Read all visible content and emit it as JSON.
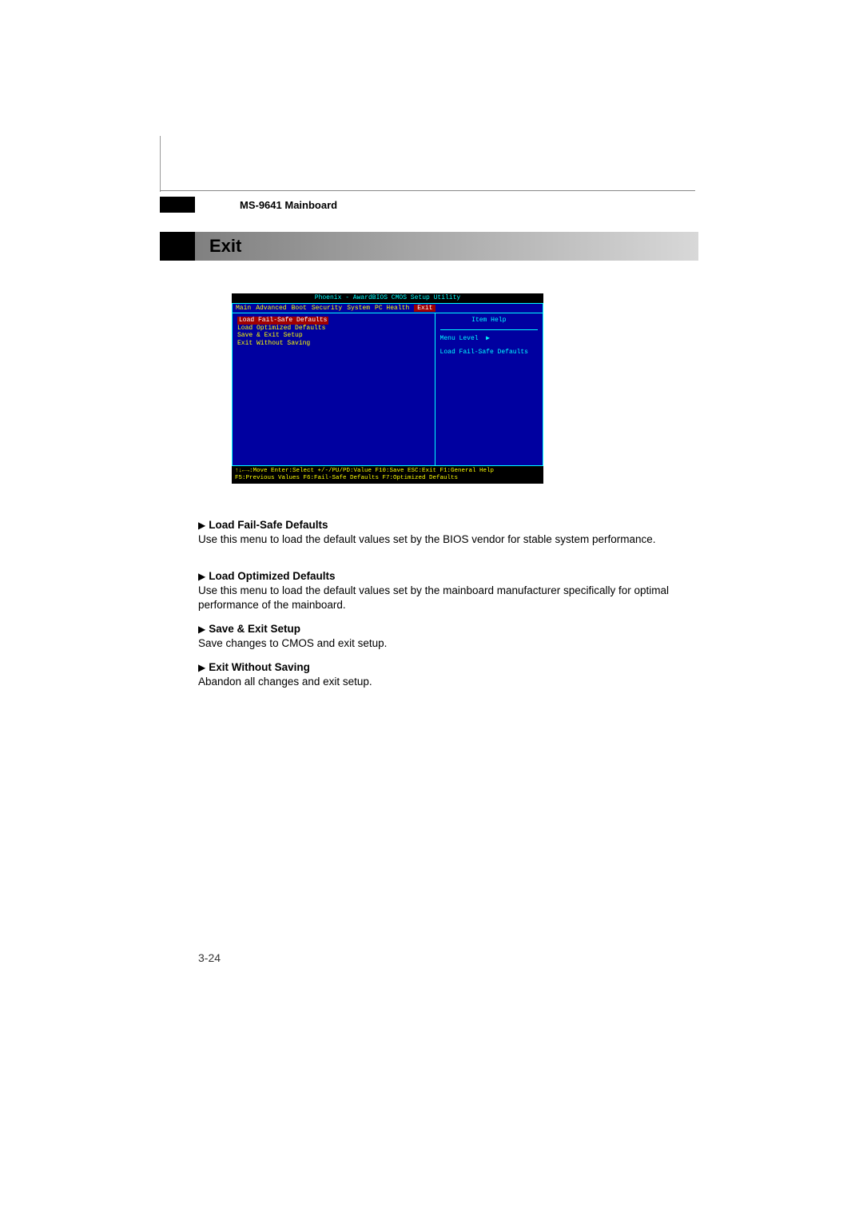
{
  "header": {
    "product": "MS-9641 Mainboard"
  },
  "section": {
    "title": "Exit"
  },
  "bios": {
    "title": "Phoenix - AwardBIOS CMOS Setup Utility",
    "menubar": [
      "Main",
      "Advanced",
      "Boot",
      "Security",
      "System",
      "PC Health",
      "Exit"
    ],
    "selected_tab": "Exit",
    "left_items": [
      "Load Fail-Safe Defaults",
      "Load Optimized Defaults",
      "Save & Exit Setup",
      "Exit Without Saving"
    ],
    "highlighted": "Load Fail-Safe Defaults",
    "right": {
      "item_help": "Item Help",
      "menu_level": "Menu Level",
      "help_text": "Load Fail-Safe Defaults"
    },
    "footer_line1": "↑↓←→:Move  Enter:Select  +/-/PU/PD:Value  F10:Save  ESC:Exit  F1:General Help",
    "footer_line2": "F5:Previous Values   F6:Fail-Safe Defaults   F7:Optimized Defaults"
  },
  "descriptions": [
    {
      "heading": "Load Fail-Safe Defaults",
      "body": "Use this menu to load the default values set by the BIOS vendor for stable system performance."
    },
    {
      "heading": "Load Optimized Defaults",
      "body": "Use this menu to load the default values set by the mainboard manufacturer specifically for optimal performance of the mainboard."
    },
    {
      "heading": "Save & Exit Setup",
      "body": "Save changes to CMOS and exit setup."
    },
    {
      "heading": "Exit Without Saving",
      "body": "Abandon all changes and exit setup."
    }
  ],
  "page_number": "3-24"
}
